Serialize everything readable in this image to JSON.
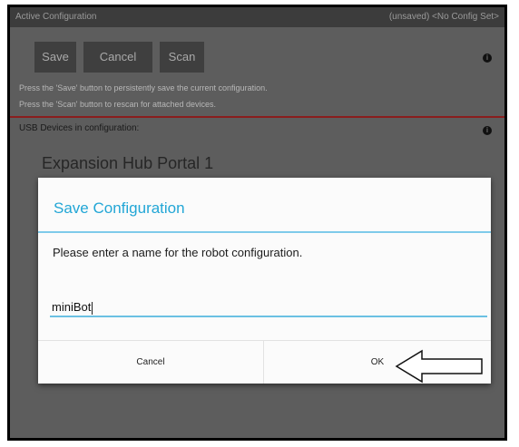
{
  "titlebar": {
    "title": "Active Configuration",
    "status": "(unsaved) <No Config Set>"
  },
  "toolbar": {
    "save_label": "Save",
    "cancel_label": "Cancel",
    "scan_label": "Scan"
  },
  "hints": {
    "line1": "Press the 'Save' button to persistently save the current configuration.",
    "line2": "Press the 'Scan' button to rescan for attached devices."
  },
  "usb_header": "USB Devices in configuration:",
  "device": {
    "name": "Expansion Hub Portal 1"
  },
  "dialog": {
    "title": "Save Configuration",
    "message": "Please enter a name for the robot configuration.",
    "input_value": "miniBot",
    "cancel_label": "Cancel",
    "ok_label": "OK"
  },
  "colors": {
    "accent": "#22a6d6",
    "app_background": "#5d5d5d",
    "title_bar": "#3c3c3c",
    "divider_red": "#8a1e1e"
  },
  "icons": [
    "info-icon",
    "arrow-left-icon"
  ]
}
